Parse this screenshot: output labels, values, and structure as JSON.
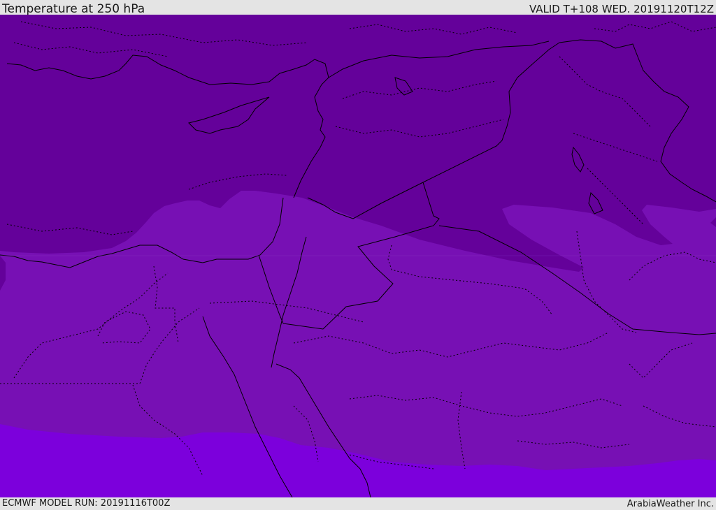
{
  "header": {
    "title": "Temperature at 250 hPa",
    "valid": "VALID T+108 WED. 20191120T12Z"
  },
  "footer": {
    "model_run": "ECMWF MODEL RUN: 20191116T00Z",
    "credit": "ArabiaWeather Inc."
  },
  "map": {
    "field": "temperature",
    "level": "250 hPa",
    "colors": {
      "cold_band": "#64019a",
      "mid_band": "#7710b4",
      "warm_band": "#7c00dc",
      "borders": "#000000"
    },
    "bands": [
      "cold_band",
      "mid_band",
      "warm_band"
    ]
  }
}
